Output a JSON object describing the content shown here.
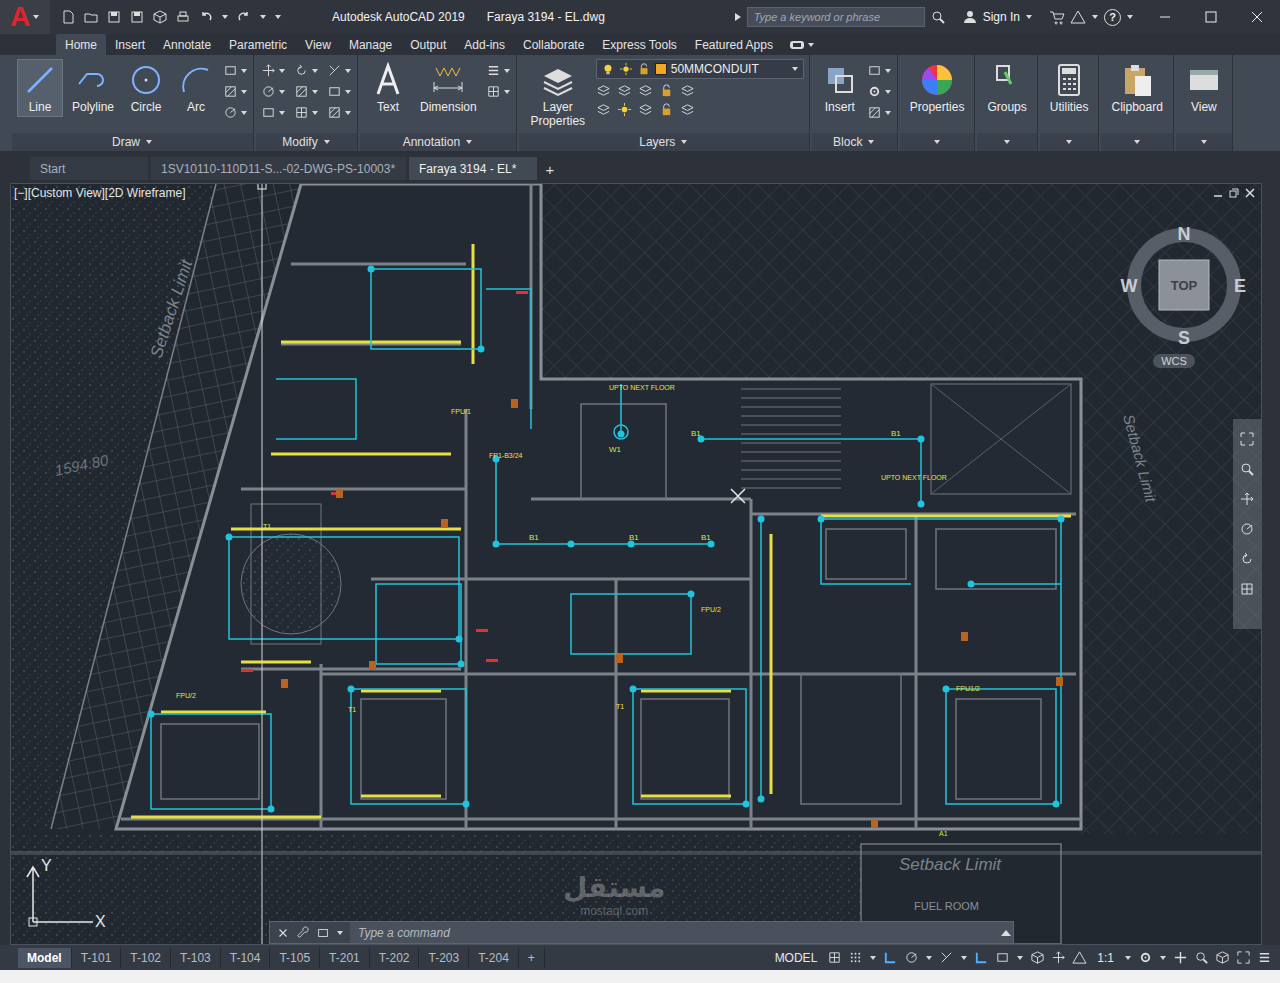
{
  "window": {
    "title": "Autodesk AutoCAD 2019",
    "file": "Faraya 3194 - EL.dwg",
    "search_placeholder": "Type a keyword or phrase",
    "sign_in": "Sign In",
    "help": "?"
  },
  "logo": "A",
  "ribbon_tabs": [
    {
      "label": "Home",
      "selected": true
    },
    {
      "label": "Insert",
      "selected": false
    },
    {
      "label": "Annotate",
      "selected": false
    },
    {
      "label": "Parametric",
      "selected": false
    },
    {
      "label": "View",
      "selected": false
    },
    {
      "label": "Manage",
      "selected": false
    },
    {
      "label": "Output",
      "selected": false
    },
    {
      "label": "Add-ins",
      "selected": false
    },
    {
      "label": "Collaborate",
      "selected": false
    },
    {
      "label": "Express Tools",
      "selected": false
    },
    {
      "label": "Featured Apps",
      "selected": false
    }
  ],
  "ribbon_panels": [
    {
      "title": "Draw",
      "kind": "full",
      "tools": [
        "Line",
        "Polyline",
        "Circle",
        "Arc"
      ]
    },
    {
      "title": "Modify",
      "kind": "full",
      "tools": []
    },
    {
      "title": "Annotation",
      "kind": "full",
      "tools": [
        "Text",
        "Dimension"
      ]
    },
    {
      "title": "Layers",
      "kind": "layers",
      "tools": [
        "Layer Properties"
      ]
    },
    {
      "title": "Block",
      "kind": "full",
      "tools": [
        "Insert"
      ]
    },
    {
      "title": "Properties",
      "kind": "collapsed",
      "tools": []
    },
    {
      "title": "Groups",
      "kind": "collapsed",
      "tools": []
    },
    {
      "title": "Utilities",
      "kind": "collapsed",
      "tools": []
    },
    {
      "title": "Clipboard",
      "kind": "collapsed",
      "tools": []
    },
    {
      "title": "View",
      "kind": "collapsed",
      "tools": []
    }
  ],
  "layer": {
    "current": "50MMCONDUIT",
    "color": "#f5a623"
  },
  "file_tabs": [
    {
      "label": "Start",
      "selected": false
    },
    {
      "label": "1SV10110-110D11-S...-02-DWG-PS-10003*",
      "selected": false
    },
    {
      "label": "Faraya 3194 - EL*",
      "selected": true
    }
  ],
  "new_tab": "+",
  "viewport": {
    "label": "[−][Custom View][2D Wireframe]"
  },
  "viewcube": {
    "north": "N",
    "south": "S",
    "east": "E",
    "west": "W",
    "face": "TOP",
    "ucs": "WCS"
  },
  "ucs_icon": {
    "x": "X",
    "y": "Y"
  },
  "command": {
    "placeholder": "Type a command"
  },
  "drawing_labels": [
    "Setback Limit",
    "Setback Limit",
    "Setback Limit",
    "FUEL ROOM",
    "UPTO NEXT FLOOR",
    "UPTO NEXT FLOOR",
    "B1",
    "B1",
    "B1",
    "B1",
    "B1",
    "W1",
    "FPU/1",
    "FPU/2",
    "FPU/2",
    "FPU1/2",
    "FP1-B3/24",
    "1594.80",
    "T1",
    "T1",
    "T1",
    "A1"
  ],
  "watermark": {
    "arabic": "مستقل",
    "latin": "mostaql.com"
  },
  "layout_tabs": [
    {
      "label": "Model",
      "selected": true
    },
    {
      "label": "T-101",
      "selected": false
    },
    {
      "label": "T-102",
      "selected": false
    },
    {
      "label": "T-103",
      "selected": false
    },
    {
      "label": "T-104",
      "selected": false
    },
    {
      "label": "T-105",
      "selected": false
    },
    {
      "label": "T-201",
      "selected": false
    },
    {
      "label": "T-202",
      "selected": false
    },
    {
      "label": "T-203",
      "selected": false
    },
    {
      "label": "T-204",
      "selected": false
    }
  ],
  "new_layout": "+",
  "status": {
    "space": "MODEL",
    "scale": "1:1"
  }
}
